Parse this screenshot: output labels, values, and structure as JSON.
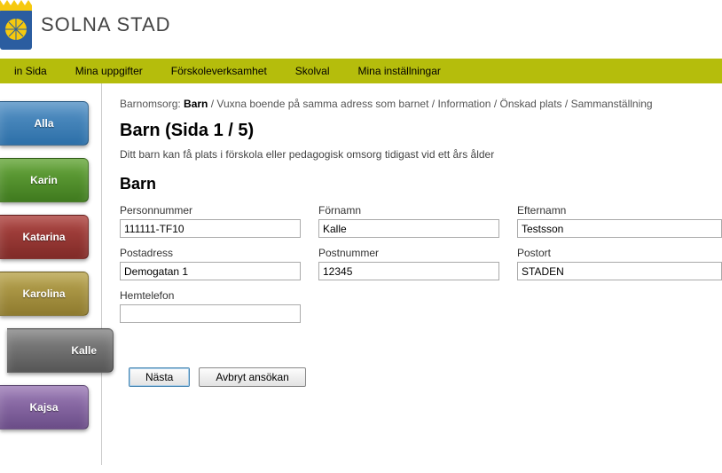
{
  "site": {
    "name": "SOLNA STAD"
  },
  "topnav": [
    {
      "label": "in Sida"
    },
    {
      "label": "Mina uppgifter"
    },
    {
      "label": "Förskoleverksamhet"
    },
    {
      "label": "Skolval"
    },
    {
      "label": "Mina inställningar"
    }
  ],
  "sidebar": [
    {
      "label": "Alla",
      "color": "blue"
    },
    {
      "label": "Karin",
      "color": "green"
    },
    {
      "label": "Katarina",
      "color": "red"
    },
    {
      "label": "Karolina",
      "color": "olive"
    },
    {
      "label": "Kalle",
      "color": "grey"
    },
    {
      "label": "Kajsa",
      "color": "purple"
    }
  ],
  "breadcrumb": {
    "prefix": "Barnomsorg:",
    "items": [
      "Barn",
      "Vuxna boende på samma adress som barnet",
      "Information",
      "Önskad plats",
      "Sammanställning"
    ],
    "activeIndex": 0,
    "sep": " / "
  },
  "page": {
    "title": "Barn (Sida 1 / 5)",
    "intro": "Ditt barn kan få plats i förskola eller pedagogisk omsorg tidigast vid ett års ålder",
    "sectionTitle": "Barn"
  },
  "form": {
    "personnummer": {
      "label": "Personnummer",
      "value": "111111-TF10"
    },
    "fornamn": {
      "label": "Förnamn",
      "value": "Kalle"
    },
    "efternamn": {
      "label": "Efternamn",
      "value": "Testsson"
    },
    "postadress": {
      "label": "Postadress",
      "value": "Demogatan 1"
    },
    "postnummer": {
      "label": "Postnummer",
      "value": "12345"
    },
    "postort": {
      "label": "Postort",
      "value": "STADEN"
    },
    "hemtelefon": {
      "label": "Hemtelefon",
      "value": ""
    }
  },
  "buttons": {
    "next": "Nästa",
    "cancel": "Avbryt ansökan"
  }
}
